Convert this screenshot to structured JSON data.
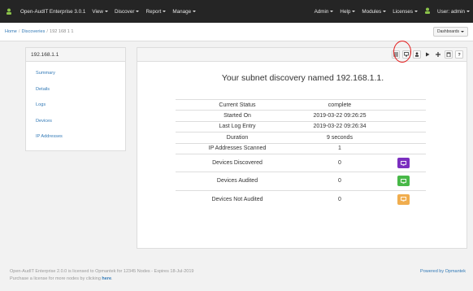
{
  "navbar": {
    "brand": "Open-AudIT Enterprise 3.0.1",
    "menus": [
      "View",
      "Discover",
      "Report",
      "Manage"
    ],
    "right_menus": [
      "Admin",
      "Help",
      "Modules",
      "Licenses"
    ],
    "user": "User: admin"
  },
  "breadcrumb": {
    "home": "Home",
    "discoveries": "Discoveries",
    "current": "192 168 1 1"
  },
  "dashboards_button": "Dashboards",
  "sidebar": {
    "title": "192.168.1.1",
    "items": [
      "Summary",
      "Details",
      "Logs",
      "Devices",
      "IP Addresses"
    ]
  },
  "main": {
    "heading": "Your subnet discovery named 192.168.1.1.",
    "rows": [
      {
        "label": "Current Status",
        "value": "complete"
      },
      {
        "label": "Started On",
        "value": "2019-03-22 09:26:25"
      },
      {
        "label": "Last Log Entry",
        "value": "2019-03-22 09:26:34"
      },
      {
        "label": "Duration",
        "value": "9 seconds"
      },
      {
        "label": "IP Addresses Scanned",
        "value": "1"
      },
      {
        "label": "Devices Discovered",
        "value": "0",
        "button_color": "#7b2fbf"
      },
      {
        "label": "Devices Audited",
        "value": "0",
        "button_color": "#48b848"
      },
      {
        "label": "Devices Not Audited",
        "value": "0",
        "button_color": "#f0ad4e"
      }
    ]
  },
  "footer": {
    "line1": "Open-AudIT Enterprise 2.0.0 is licensed to Opmantek for 12345 Nodes - Expires 18-Jul-2019",
    "line2_prefix": "Purchase a license for more nodes by clicking ",
    "line2_link": "here",
    "line2_suffix": ".",
    "powered": "Powered by Opmantek"
  },
  "toolbar_icons": [
    "list-icon",
    "monitor-icon",
    "user-icon",
    "play-icon",
    "plus-icon",
    "trash-icon",
    "help-icon"
  ]
}
